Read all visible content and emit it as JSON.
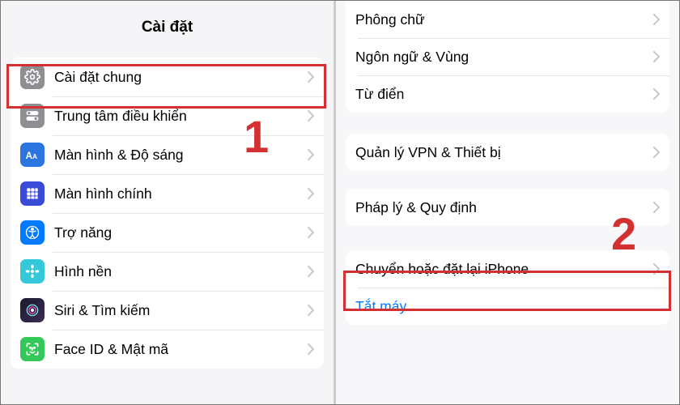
{
  "left": {
    "title": "Cài đặt",
    "items": [
      {
        "label": "Cài đặt chung"
      },
      {
        "label": "Trung tâm điều khiển"
      },
      {
        "label": "Màn hình & Độ sáng"
      },
      {
        "label": "Màn hình chính"
      },
      {
        "label": "Trợ năng"
      },
      {
        "label": "Hình nền"
      },
      {
        "label": "Siri & Tìm kiếm"
      },
      {
        "label": "Face ID & Mật mã"
      }
    ]
  },
  "right": {
    "group1": [
      {
        "label": "Phông chữ"
      },
      {
        "label": "Ngôn ngữ & Vùng"
      },
      {
        "label": "Từ điển"
      }
    ],
    "group2": [
      {
        "label": "Quản lý VPN & Thiết bị"
      }
    ],
    "group3": [
      {
        "label": "Pháp lý & Quy định"
      }
    ],
    "group4": [
      {
        "label": "Chuyển hoặc đặt lại iPhone"
      },
      {
        "label": "Tắt máy"
      }
    ]
  },
  "annotations": {
    "step1": "1",
    "step2": "2"
  }
}
